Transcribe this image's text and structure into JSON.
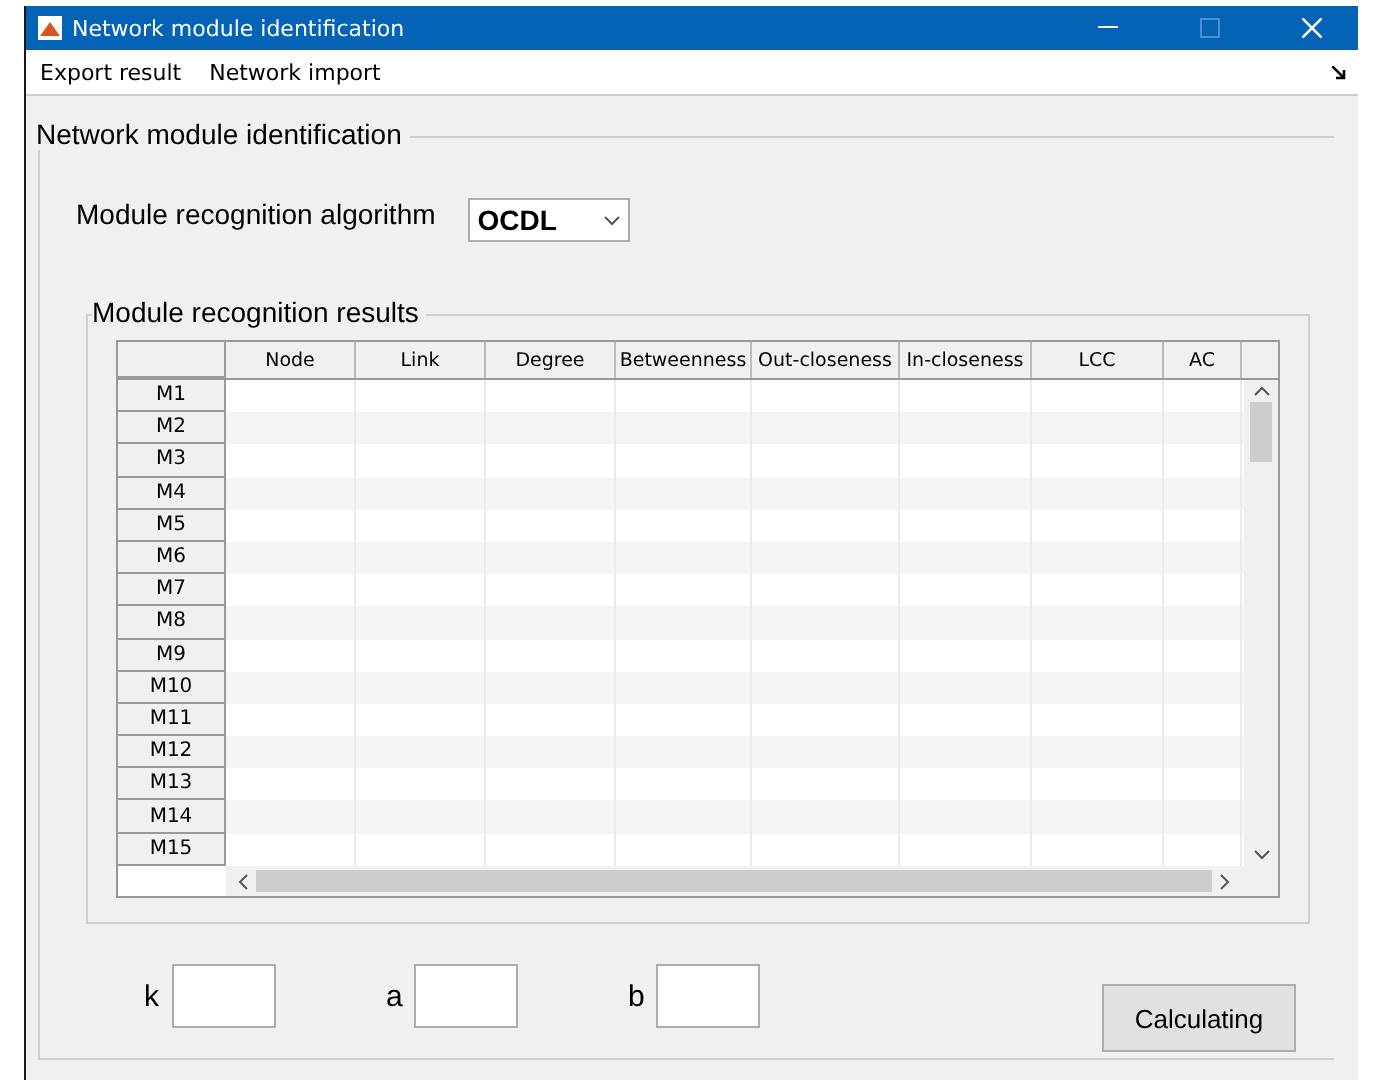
{
  "window": {
    "title": "Network module identification"
  },
  "menu": [
    "Export result",
    "Network import"
  ],
  "panel": {
    "title": "Network module identification"
  },
  "algorithm": {
    "label": "Module recognition algorithm",
    "value": "OCDL"
  },
  "results": {
    "title": "Module recognition results",
    "columns": [
      "Node",
      "Link",
      "Degree",
      "Betweenness",
      "Out-closeness",
      "In-closeness",
      "LCC",
      "AC"
    ],
    "rows": [
      "M1",
      "M2",
      "M3",
      "M4",
      "M5",
      "M6",
      "M7",
      "M8",
      "M9",
      "M10",
      "M11",
      "M12",
      "M13",
      "M14",
      "M15"
    ]
  },
  "params": [
    {
      "label": "k"
    },
    {
      "label": "a"
    },
    {
      "label": "b"
    }
  ],
  "button": "Calculating"
}
